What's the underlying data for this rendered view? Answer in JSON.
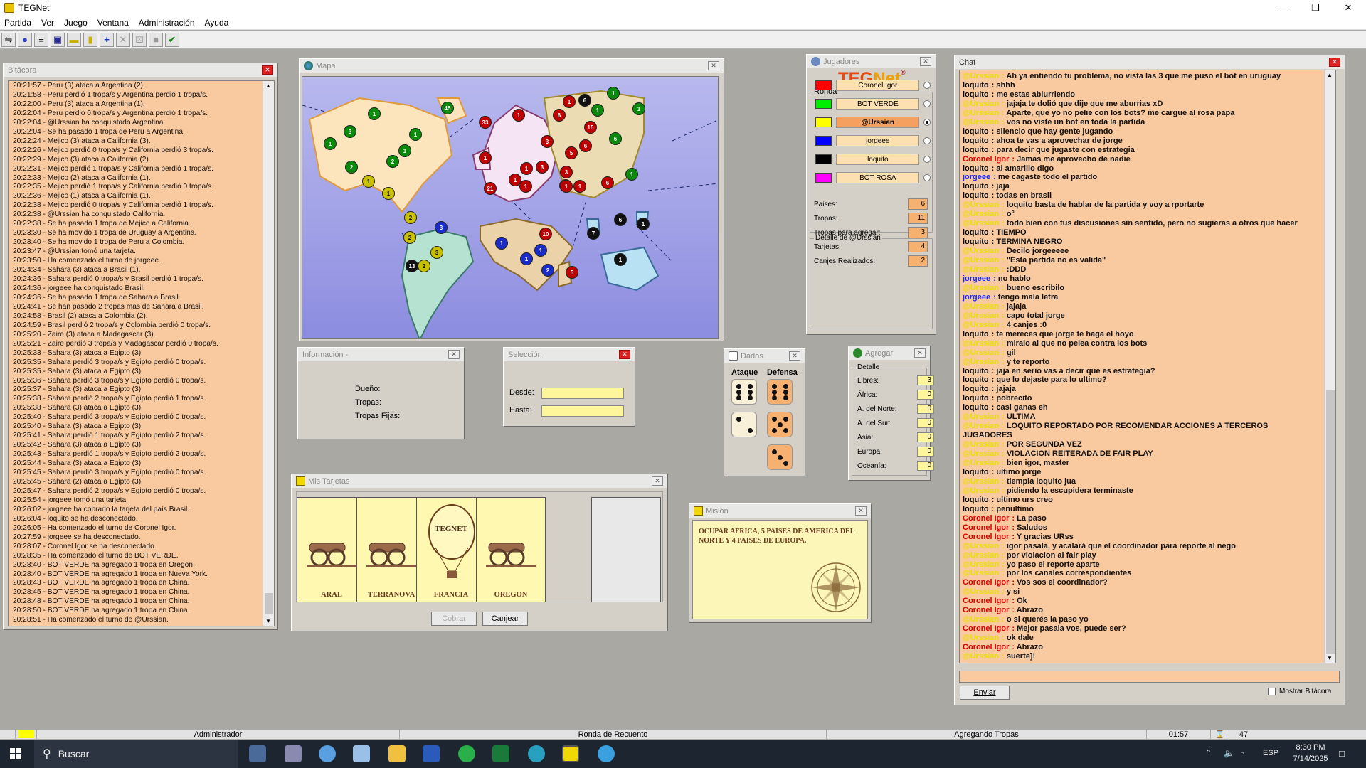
{
  "app": {
    "title": "TEGNet"
  },
  "menu": [
    "Partida",
    "Ver",
    "Juego",
    "Ventana",
    "Administración",
    "Ayuda"
  ],
  "toolbar_icons": [
    "connect-icon",
    "globe-icon",
    "list-icon",
    "save-icon",
    "card-icon",
    "mission-icon",
    "add-icon",
    "delete-icon",
    "dice-icon",
    "stop-icon",
    "check-icon"
  ],
  "bitacora": {
    "title": "Bitácora",
    "lines": [
      "20:21:57 - Peru (3) ataca a Argentina (2).",
      "20:21:58 - Peru perdió 1 tropa/s y Argentina perdió 1 tropa/s.",
      "20:22:00 - Peru (3) ataca a Argentina (1).",
      "20:22:04 - Peru perdió 0 tropa/s y Argentina perdió 1 tropa/s.",
      "20:22:04 - @Urssian ha conquistado Argentina.",
      "20:22:04 - Se ha pasado 1 tropa de Peru a Argentina.",
      "20:22:24 - Mejico (3) ataca a California (3).",
      "20:22:26 - Mejico perdió 0 tropa/s y California perdió 3 tropa/s.",
      "20:22:29 - Mejico (3) ataca a California (2).",
      "20:22:31 - Mejico perdió 1 tropa/s y California perdió 1 tropa/s.",
      "20:22:33 - Mejico (2) ataca a California (1).",
      "20:22:35 - Mejico perdió 1 tropa/s y California perdió 0 tropa/s.",
      "20:22:36 - Mejico (1) ataca a California (1).",
      "20:22:38 - Mejico perdió 0 tropa/s y California perdió 1 tropa/s.",
      "20:22:38 - @Urssian ha conquistado California.",
      "20:22:38 - Se ha pasado 1 tropa de Mejico a California.",
      "20:23:30 - Se ha movido 1 tropa de Uruguay a Argentina.",
      "20:23:40 - Se ha movido 1 tropa de Peru a Colombia.",
      "20:23:47 - @Urssian tomó una tarjeta.",
      "20:23:50 - Ha comenzado el turno de jorgeee.",
      "20:24:34 - Sahara (3) ataca a Brasil (1).",
      "20:24:36 - Sahara perdió 0 tropa/s y Brasil perdió 1 tropa/s.",
      "20:24:36 - jorgeee ha conquistado Brasil.",
      "20:24:36 - Se ha pasado 1 tropa de Sahara a Brasil.",
      "20:24:41 - Se han pasado 2 tropas mas de Sahara a Brasil.",
      "20:24:58 - Brasil (2) ataca a Colombia (2).",
      "20:24:59 - Brasil perdió 2 tropa/s y Colombia perdió 0 tropa/s.",
      "20:25:20 - Zaire (3) ataca a Madagascar (3).",
      "20:25:21 - Zaire perdió 3 tropa/s y Madagascar perdió 0 tropa/s.",
      "20:25:33 - Sahara (3) ataca a Egipto (3).",
      "20:25:35 - Sahara perdió 3 tropa/s y Egipto perdió 0 tropa/s.",
      "20:25:35 - Sahara (3) ataca a Egipto (3).",
      "20:25:36 - Sahara perdió 3 tropa/s y Egipto perdió 0 tropa/s.",
      "20:25:37 - Sahara (3) ataca a Egipto (3).",
      "20:25:38 - Sahara perdió 2 tropa/s y Egipto perdió 1 tropa/s.",
      "20:25:38 - Sahara (3) ataca a Egipto (3).",
      "20:25:40 - Sahara perdió 3 tropa/s y Egipto perdió 0 tropa/s.",
      "20:25:40 - Sahara (3) ataca a Egipto (3).",
      "20:25:41 - Sahara perdió 1 tropa/s y Egipto perdió 2 tropa/s.",
      "20:25:42 - Sahara (3) ataca a Egipto (3).",
      "20:25:43 - Sahara perdió 1 tropa/s y Egipto perdió 2 tropa/s.",
      "20:25:44 - Sahara (3) ataca a Egipto (3).",
      "20:25:45 - Sahara perdió 3 tropa/s y Egipto perdió 0 tropa/s.",
      "20:25:45 - Sahara (2) ataca a Egipto (3).",
      "20:25:47 - Sahara perdió 2 tropa/s y Egipto perdió 0 tropa/s.",
      "20:25:54 - jorgeee tomó una tarjeta.",
      "20:26:02 - jorgeee ha cobrado la tarjeta del país Brasil.",
      "20:26:04 - loquito se ha desconectado.",
      "20:26:05 - Ha comenzado el turno de Coronel Igor.",
      "20:27:59 - jorgeee se ha desconectado.",
      "20:28:07 - Coronel Igor se ha desconectado.",
      "20:28:35 - Ha comenzado el turno de BOT VERDE.",
      "20:28:40 - BOT VERDE ha agregado 1 tropa en Oregon.",
      "20:28:40 - BOT VERDE ha agregado 1 tropa en Nueva York.",
      "20:28:43 - BOT VERDE ha agregado 1 tropa en China.",
      "20:28:45 - BOT VERDE ha agregado 1 tropa en China.",
      "20:28:48 - BOT VERDE ha agregado 1 tropa en China.",
      "20:28:50 - BOT VERDE ha agregado 1 tropa en China.",
      "20:28:51 - Ha comenzado el turno de @Urssian."
    ]
  },
  "mapa": {
    "title": "Mapa",
    "markers": [
      {
        "v": "1",
        "c": "#0a8a0a"
      },
      {
        "v": "3",
        "c": "#0a8a0a"
      },
      {
        "v": "1",
        "c": "#0a8a0a"
      },
      {
        "v": "2",
        "c": "#0a8a0a"
      },
      {
        "v": "1",
        "c": "#0a8a0a"
      },
      {
        "v": "2",
        "c": "#0a8a0a"
      },
      {
        "v": "1",
        "c": "#0a8a0a"
      },
      {
        "v": "45",
        "c": "#0a8a0a"
      },
      {
        "v": "1",
        "c": "#c8c000"
      },
      {
        "v": "1",
        "c": "#c8c000"
      },
      {
        "v": "33",
        "c": "#c00000"
      },
      {
        "v": "1",
        "c": "#c00000"
      },
      {
        "v": "1",
        "c": "#c00000"
      },
      {
        "v": "21",
        "c": "#c00000"
      },
      {
        "v": "1",
        "c": "#c00000"
      },
      {
        "v": "1",
        "c": "#c00000"
      },
      {
        "v": "3",
        "c": "#c00000"
      },
      {
        "v": "3",
        "c": "#c00000"
      },
      {
        "v": "1",
        "c": "#c00000"
      },
      {
        "v": "1",
        "c": "#c00000"
      },
      {
        "v": "6",
        "c": "#c00000"
      },
      {
        "v": "1",
        "c": "#c00000"
      },
      {
        "v": "6",
        "c": "#111"
      },
      {
        "v": "1",
        "c": "#0a8a0a"
      },
      {
        "v": "1",
        "c": "#0a8a0a"
      },
      {
        "v": "1",
        "c": "#0a8a0a"
      },
      {
        "v": "15",
        "c": "#c00000"
      },
      {
        "v": "6",
        "c": "#c00000"
      },
      {
        "v": "6",
        "c": "#0a8a0a"
      },
      {
        "v": "5",
        "c": "#c00000"
      },
      {
        "v": "3",
        "c": "#c00000"
      },
      {
        "v": "1",
        "c": "#c00000"
      },
      {
        "v": "1",
        "c": "#c00000"
      },
      {
        "v": "6",
        "c": "#c00000"
      },
      {
        "v": "1",
        "c": "#0a8a0a"
      },
      {
        "v": "2",
        "c": "#c8c000"
      },
      {
        "v": "2",
        "c": "#c8c000"
      },
      {
        "v": "3",
        "c": "#1a2cc8"
      },
      {
        "v": "3",
        "c": "#c8c000"
      },
      {
        "v": "2",
        "c": "#c8c000"
      },
      {
        "v": "13",
        "c": "#111"
      },
      {
        "v": "1",
        "c": "#1a2cc8"
      },
      {
        "v": "10",
        "c": "#c00000"
      },
      {
        "v": "1",
        "c": "#1a2cc8"
      },
      {
        "v": "1",
        "c": "#1a2cc8"
      },
      {
        "v": "2",
        "c": "#1a2cc8"
      },
      {
        "v": "5",
        "c": "#c00000"
      },
      {
        "v": "7",
        "c": "#111"
      },
      {
        "v": "6",
        "c": "#111"
      },
      {
        "v": "1",
        "c": "#111"
      },
      {
        "v": "1",
        "c": "#111"
      }
    ]
  },
  "jugadores": {
    "title": "Jugadores",
    "brand": "TEGNet",
    "ronda_label": "Ronda",
    "players": [
      {
        "name": "Coronel Igor",
        "color": "#ff0000",
        "active": false
      },
      {
        "name": "BOT VERDE",
        "color": "#00ee00",
        "active": false
      },
      {
        "name": "@Urssian",
        "color": "#ffff00",
        "active": true
      },
      {
        "name": "jorgeee",
        "color": "#0000ff",
        "active": false
      },
      {
        "name": "loquito",
        "color": "#000000",
        "active": false
      },
      {
        "name": "BOT ROSA",
        "color": "#ff00ff",
        "active": false
      }
    ],
    "detalle_title": "Detalle de @Urssian",
    "detalle": [
      {
        "label": "Paises:",
        "value": "6"
      },
      {
        "label": "Tropas:",
        "value": "11"
      },
      {
        "label": "Tropas para agregar:",
        "value": "3"
      },
      {
        "label": "Tarjetas:",
        "value": "4"
      },
      {
        "label": "Canjes Realizados:",
        "value": "2"
      }
    ]
  },
  "informacion": {
    "title": "Información -",
    "labels": [
      "Dueño:",
      "Tropas:",
      "Tropas Fijas:"
    ]
  },
  "seleccion": {
    "title": "Selección",
    "desde": "Desde:",
    "hasta": "Hasta:"
  },
  "dados": {
    "title": "Dados",
    "ataque": "Ataque",
    "defensa": "Defensa",
    "attack_dice": [
      6,
      2
    ],
    "defense_dice": [
      6,
      5,
      3
    ]
  },
  "agregar": {
    "title": "Agregar",
    "detalle": "Detalle",
    "rows": [
      {
        "label": "Libres:",
        "value": "3"
      },
      {
        "label": "África:",
        "value": "0"
      },
      {
        "label": "A. del Norte:",
        "value": "0"
      },
      {
        "label": "A. del Sur:",
        "value": "0"
      },
      {
        "label": "Asia:",
        "value": "0"
      },
      {
        "label": "Europa:",
        "value": "0"
      },
      {
        "label": "Oceanía:",
        "value": "0"
      }
    ]
  },
  "tarjetas": {
    "title": "Mis Tarjetas",
    "cards": [
      {
        "name": "ARAL",
        "kind": "canon"
      },
      {
        "name": "TERRANOVA",
        "kind": "canon"
      },
      {
        "name": "FRANCIA",
        "kind": "globo"
      },
      {
        "name": "OREGON",
        "kind": "canon"
      }
    ],
    "globo_text": "TEGNET",
    "cobrar": "Cobrar",
    "canjear": "Canjear"
  },
  "mision": {
    "title": "Misión",
    "text": "OCUPAR AFRICA, 5 PAISES DE AMERICA DEL NORTE Y 4 PAISES DE EUROPA."
  },
  "chat": {
    "title": "Chat",
    "name_colors": {
      "@Urssian": "#e8e000",
      "loquito": "#000000",
      "Coronel Igor": "#e00000",
      "jorgeee": "#1a2cff"
    },
    "messages": [
      {
        "n": "@Urssian",
        "t": "Ah ya entiendo tu problema, no vista las 3 que me puso el bot en uruguay"
      },
      {
        "n": "loquito",
        "t": "shhh"
      },
      {
        "n": "loquito",
        "t": "me estas abiurriendo"
      },
      {
        "n": "@Urssian",
        "t": "jajaja te dolió que dije que me aburrias xD"
      },
      {
        "n": "@Urssian",
        "t": "Aparte, que yo no pelie con los bots? me cargue al rosa papa"
      },
      {
        "n": "@Urssian",
        "t": "vos no viste un bot en toda la partida"
      },
      {
        "n": "loquito",
        "t": "silencio que hay gente jugando"
      },
      {
        "n": "loquito",
        "t": "ahoa te vas a aprovechar de jorge"
      },
      {
        "n": "loquito",
        "t": "para decir que jugaste con estrategia"
      },
      {
        "n": "Coronel Igor",
        "t": "Jamas me aprovecho de nadie"
      },
      {
        "n": "loquito",
        "t": "al amarillo digo"
      },
      {
        "n": "jorgeee",
        "t": "me cagaste todo el partido"
      },
      {
        "n": "loquito",
        "t": "jaja"
      },
      {
        "n": "loquito",
        "t": "todas en brasil"
      },
      {
        "n": "@Urssian",
        "t": "loquito basta de hablar de la partida y voy a rportarte"
      },
      {
        "n": "@Urssian",
        "t": "o°"
      },
      {
        "n": "@Urssian",
        "t": "todo bien con tus discusiones sin sentido, pero no sugieras a otros que hacer"
      },
      {
        "n": "loquito",
        "t": "TIEMPO"
      },
      {
        "n": "loquito",
        "t": "TERMINA NEGRO"
      },
      {
        "n": "@Urssian",
        "t": "Decilo jorgeeeee"
      },
      {
        "n": "@Urssian",
        "t": "\"Esta partida no es valida\""
      },
      {
        "n": "@Urssian",
        "t": ":DDD"
      },
      {
        "n": "jorgeee",
        "t": "no hablo"
      },
      {
        "n": "@Urssian",
        "t": "bueno escribilo"
      },
      {
        "n": "jorgeee",
        "t": "tengo mala letra"
      },
      {
        "n": "@Urssian",
        "t": "jajaja"
      },
      {
        "n": "@Urssian",
        "t": "capo total jorge"
      },
      {
        "n": "@Urssian",
        "t": "4 canjes :0"
      },
      {
        "n": "loquito",
        "t": "te mereces que jorge te haga el hoyo"
      },
      {
        "n": "@Urssian",
        "t": "miralo al que no pelea contra los bots"
      },
      {
        "n": "@Urssian",
        "t": "gil"
      },
      {
        "n": "@Urssian",
        "t": "y te reporto"
      },
      {
        "n": "loquito",
        "t": "jaja en serio vas a decir que es estrategia?"
      },
      {
        "n": "loquito",
        "t": "que lo dejaste para lo ultimo?"
      },
      {
        "n": "loquito",
        "t": "jajaja"
      },
      {
        "n": "loquito",
        "t": "pobrecito"
      },
      {
        "n": "loquito",
        "t": "casi ganas eh"
      },
      {
        "n": "@Urssian",
        "t": "ULTIMA"
      },
      {
        "n": "@Urssian",
        "t": "LOQUITO REPORTADO POR RECOMENDAR ACCIONES A TERCEROS"
      },
      {
        "n": "",
        "t": "JUGADORES"
      },
      {
        "n": "@Urssian",
        "t": "POR SEGUNDA VEZ"
      },
      {
        "n": "@Urssian",
        "t": "VIOLACION REITERADA DE FAIR PLAY"
      },
      {
        "n": "@Urssian",
        "t": "bien igor, master"
      },
      {
        "n": "loquito",
        "t": "ultimo jorge"
      },
      {
        "n": "@Urssian",
        "t": "tiempla loquito jua"
      },
      {
        "n": "@Urssian",
        "t": "pidiendo la escupidera terminaste"
      },
      {
        "n": "loquito",
        "t": "ultimo urs creo"
      },
      {
        "n": "loquito",
        "t": "penultimo"
      },
      {
        "n": "Coronel Igor",
        "t": "La paso"
      },
      {
        "n": "Coronel Igor",
        "t": "Saludos"
      },
      {
        "n": "Coronel Igor",
        "t": "Y gracias URss"
      },
      {
        "n": "@Urssian",
        "t": "igor pasala, y acalará que el coordinador para reporte al nego"
      },
      {
        "n": "@Urssian",
        "t": "por violacion al fair play"
      },
      {
        "n": "@Urssian",
        "t": "yo paso el reporte aparte"
      },
      {
        "n": "@Urssian",
        "t": "por los canales correspondientes"
      },
      {
        "n": "Coronel Igor",
        "t": "Vos sos el coordinador?"
      },
      {
        "n": "@Urssian",
        "t": "y si"
      },
      {
        "n": "Coronel Igor",
        "t": "Ok"
      },
      {
        "n": "Coronel Igor",
        "t": "Abrazo"
      },
      {
        "n": "@Urssian",
        "t": "o si querés la paso yo"
      },
      {
        "n": "Coronel Igor",
        "t": "Mejor pasala vos, puede ser?"
      },
      {
        "n": "@Urssian",
        "t": "ok dale"
      },
      {
        "n": "Coronel Igor",
        "t": "Abrazo"
      },
      {
        "n": "@Urssian",
        "t": "suerte]!"
      }
    ],
    "enviar": "Enviar",
    "mostrar_bitacora": "Mostrar Bitácora"
  },
  "status": {
    "user": "Administrador",
    "phase": "Ronda de Recuento",
    "action": "Agregando Tropas",
    "timer": "01:57",
    "count": "47"
  },
  "taskbar": {
    "search": "Buscar",
    "time": "8:30 PM",
    "date": "7/14/2025",
    "lang": "ESP"
  }
}
